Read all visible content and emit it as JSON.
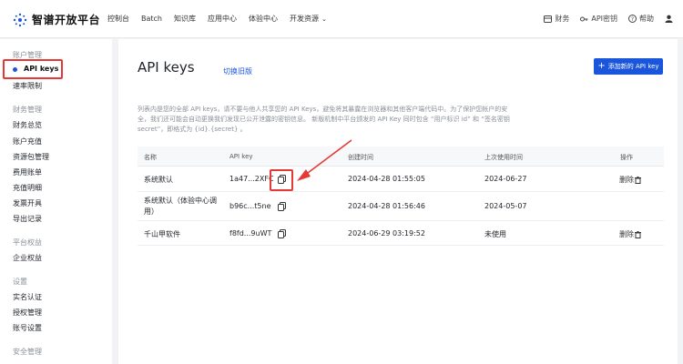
{
  "header": {
    "logo_text": "智谱开放平台",
    "nav": [
      "控制台",
      "Batch",
      "知识库",
      "应用中心",
      "体验中心",
      "开发资源"
    ],
    "right": [
      {
        "icon": "wallet-icon",
        "label": "财务"
      },
      {
        "icon": "key-icon",
        "label": "API密钥"
      },
      {
        "icon": "help-icon",
        "label": "帮助"
      }
    ]
  },
  "sidebar": {
    "groups": [
      {
        "title": "账户管理",
        "items": [
          "API keys",
          "速率限制"
        ]
      },
      {
        "title": "财务管理",
        "items": [
          "财务总览",
          "账户充值",
          "资源包管理",
          "费用账单",
          "充值明细",
          "发票开具",
          "导出记录"
        ]
      },
      {
        "title": "平台权益",
        "items": [
          "企业权益"
        ]
      },
      {
        "title": "设置",
        "items": [
          "实名认证",
          "授权管理",
          "账号设置"
        ]
      },
      {
        "title": "安全管理",
        "items": []
      }
    ],
    "active": "API keys"
  },
  "main": {
    "title": "API keys",
    "switch_link": "切换旧版",
    "add_button": "添加新的 API key",
    "description": "列表内是您的全部 API keys，请不要与他人共享您的 API Keys，避免将其暴露在浏览器和其他客户端代码中。为了保护您帐户的安全，我们还可能会自动更换我们发现已公开泄露的密钥信息。 新版机制中平台颁发的 API Key 同时包含 “用户标识 id” 和 “签名密钥 secret”，即格式为 {id}.{secret} 。",
    "columns": [
      "名称",
      "API key",
      "创建时间",
      "上次使用时间",
      "操作"
    ],
    "rows": [
      {
        "name": "系统默认",
        "key": "1a47...2XFC",
        "created": "2024-04-28 01:55:05",
        "last_used": "2024-06-27",
        "action": "删除"
      },
      {
        "name": "系统默认（体验中心调用）",
        "key": "b96c...t5ne",
        "created": "2024-04-28 01:56:46",
        "last_used": "2024-05-07",
        "action": ""
      },
      {
        "name": "千山甲软件",
        "key": "f8fd...9uWT",
        "created": "2024-06-29 03:19:52",
        "last_used": "未使用",
        "action": "删除"
      }
    ]
  },
  "colors": {
    "accent": "#1a56db",
    "highlight": "#e53935"
  }
}
